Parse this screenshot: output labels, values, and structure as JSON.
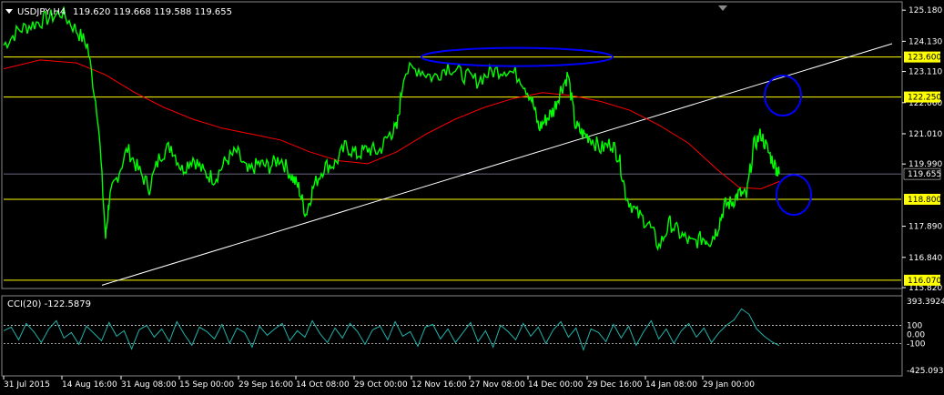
{
  "header": {
    "symbol": "USDJPY,H4",
    "ohlc": "119.620 119.668 119.588 119.655",
    "menu_icon": "triangle-down-icon"
  },
  "cci_header": {
    "label": "CCI(20) -122.5879"
  },
  "colors": {
    "background": "#000000",
    "price": "#00ff00",
    "moving_average": "#ff0000",
    "horizontal_level": "#ffff00",
    "trendline": "#ffffff",
    "ellipse": "#0000ff",
    "cci": "#20b2aa",
    "grid": "#ffffff",
    "highlight_label_bg": "#ffff00",
    "current_price_label_bg": "#000000"
  },
  "chart_data": {
    "type": "line",
    "symbol": "USDJPY",
    "timeframe": "H4",
    "price_axis": {
      "ticks": [
        "125.180",
        "124.130",
        "123.110",
        "122.060",
        "121.010",
        "119.990",
        "117.890",
        "116.840",
        "115.820"
      ],
      "ylim": [
        115.82,
        125.4
      ]
    },
    "time_axis": {
      "ticks": [
        "31 Jul 2015",
        "14 Aug 16:00",
        "31 Aug 08:00",
        "15 Sep 00:00",
        "29 Sep 16:00",
        "14 Oct 08:00",
        "29 Oct 00:00",
        "12 Nov 16:00",
        "27 Nov 08:00",
        "14 Dec 00:00",
        "29 Dec 16:00",
        "14 Jan 08:00",
        "29 Jan 00:00"
      ]
    },
    "levels": [
      {
        "value": 123.6,
        "label": "123.600",
        "color": "#ffff00"
      },
      {
        "value": 122.25,
        "label": "122.250",
        "color": "#ffff00"
      },
      {
        "value": 118.8,
        "label": "118.800",
        "color": "#ffff00"
      },
      {
        "value": 116.07,
        "label": "116.070",
        "color": "#ffff00"
      }
    ],
    "current_price": {
      "value": 119.655,
      "label": "119.655"
    },
    "trendline": {
      "from": {
        "bar": 0.135,
        "price": 115.9
      },
      "to": {
        "bar": 1.22,
        "price": 124.05
      }
    },
    "series": [
      {
        "kind": "price",
        "points": [
          [
            0.0,
            124.0
          ],
          [
            0.02,
            124.5
          ],
          [
            0.04,
            124.7
          ],
          [
            0.06,
            124.9
          ],
          [
            0.08,
            125.1
          ],
          [
            0.1,
            124.5
          ],
          [
            0.115,
            124.0
          ],
          [
            0.13,
            121.5
          ],
          [
            0.14,
            117.5
          ],
          [
            0.145,
            118.8
          ],
          [
            0.155,
            119.5
          ],
          [
            0.17,
            120.5
          ],
          [
            0.185,
            119.8
          ],
          [
            0.2,
            119.2
          ],
          [
            0.215,
            120.3
          ],
          [
            0.23,
            120.6
          ],
          [
            0.245,
            119.8
          ],
          [
            0.26,
            120.2
          ],
          [
            0.275,
            119.7
          ],
          [
            0.29,
            119.5
          ],
          [
            0.305,
            120.1
          ],
          [
            0.32,
            120.4
          ],
          [
            0.335,
            119.7
          ],
          [
            0.35,
            120.0
          ],
          [
            0.365,
            119.9
          ],
          [
            0.38,
            120.2
          ],
          [
            0.395,
            119.6
          ],
          [
            0.405,
            119.2
          ],
          [
            0.415,
            118.3
          ],
          [
            0.425,
            119.2
          ],
          [
            0.44,
            119.9
          ],
          [
            0.455,
            120.0
          ],
          [
            0.47,
            120.6
          ],
          [
            0.485,
            120.3
          ],
          [
            0.5,
            120.5
          ],
          [
            0.515,
            120.4
          ],
          [
            0.53,
            121.0
          ],
          [
            0.54,
            121.2
          ],
          [
            0.55,
            123.1
          ],
          [
            0.57,
            123.2
          ],
          [
            0.59,
            122.9
          ],
          [
            0.61,
            123.3
          ],
          [
            0.63,
            123.0
          ],
          [
            0.65,
            122.8
          ],
          [
            0.67,
            123.1
          ],
          [
            0.69,
            123.2
          ],
          [
            0.71,
            122.9
          ],
          [
            0.725,
            122.2
          ],
          [
            0.735,
            121.2
          ],
          [
            0.745,
            121.5
          ],
          [
            0.755,
            121.8
          ],
          [
            0.765,
            122.5
          ],
          [
            0.775,
            123.0
          ],
          [
            0.785,
            121.3
          ],
          [
            0.795,
            121.0
          ],
          [
            0.805,
            120.9
          ],
          [
            0.82,
            120.5
          ],
          [
            0.835,
            120.7
          ],
          [
            0.845,
            120.2
          ],
          [
            0.855,
            118.9
          ],
          [
            0.87,
            118.3
          ],
          [
            0.885,
            118.0
          ],
          [
            0.9,
            117.2
          ],
          [
            0.915,
            118.0
          ],
          [
            0.93,
            117.6
          ],
          [
            0.945,
            117.3
          ],
          [
            0.96,
            117.5
          ],
          [
            0.97,
            117.4
          ],
          [
            0.98,
            117.8
          ],
          [
            0.99,
            118.6
          ],
          [
            1.0,
            118.7
          ],
          [
            1.01,
            119.0
          ],
          [
            1.02,
            118.9
          ],
          [
            1.03,
            120.6
          ],
          [
            1.04,
            121.0
          ],
          [
            1.05,
            120.4
          ],
          [
            1.06,
            119.9
          ],
          [
            1.065,
            119.655
          ]
        ]
      },
      {
        "kind": "moving_average",
        "points": [
          [
            0.0,
            123.2
          ],
          [
            0.05,
            123.5
          ],
          [
            0.1,
            123.4
          ],
          [
            0.14,
            123.0
          ],
          [
            0.18,
            122.4
          ],
          [
            0.22,
            121.9
          ],
          [
            0.26,
            121.5
          ],
          [
            0.3,
            121.2
          ],
          [
            0.34,
            121.0
          ],
          [
            0.38,
            120.8
          ],
          [
            0.42,
            120.4
          ],
          [
            0.46,
            120.1
          ],
          [
            0.5,
            120.0
          ],
          [
            0.54,
            120.4
          ],
          [
            0.58,
            121.0
          ],
          [
            0.62,
            121.5
          ],
          [
            0.66,
            121.9
          ],
          [
            0.7,
            122.2
          ],
          [
            0.74,
            122.4
          ],
          [
            0.78,
            122.3
          ],
          [
            0.82,
            122.1
          ],
          [
            0.86,
            121.8
          ],
          [
            0.9,
            121.3
          ],
          [
            0.94,
            120.7
          ],
          [
            0.98,
            119.8
          ],
          [
            1.01,
            119.2
          ],
          [
            1.04,
            119.15
          ],
          [
            1.065,
            119.4
          ]
        ]
      }
    ],
    "cci": {
      "name": "CCI(20)",
      "current": -122.5879,
      "axis_labels": [
        "393.3924",
        "100",
        "0.00",
        "-100",
        "-425.0932"
      ],
      "ylim": [
        -425.0932,
        393.3924
      ],
      "levels": [
        100,
        -100
      ],
      "values": [
        40,
        80,
        -60,
        120,
        30,
        -90,
        60,
        150,
        -40,
        20,
        -110,
        90,
        10,
        -70,
        130,
        -20,
        40,
        -160,
        50,
        100,
        -30,
        60,
        -80,
        140,
        0,
        -120,
        80,
        30,
        -50,
        110,
        -100,
        70,
        20,
        -140,
        90,
        -10,
        60,
        120,
        -70,
        40,
        -30,
        150,
        10,
        -90,
        70,
        -40,
        120,
        30,
        -110,
        50,
        90,
        -60,
        140,
        -20,
        30,
        -130,
        80,
        110,
        -50,
        60,
        -90,
        20,
        130,
        -80,
        40,
        -140,
        100,
        30,
        -60,
        120,
        -20,
        80,
        -100,
        50,
        140,
        -30,
        70,
        -170,
        60,
        20,
        -80,
        110,
        -40,
        90,
        -120,
        30,
        150,
        -50,
        60,
        -100,
        40,
        120,
        -30,
        70,
        -90,
        20,
        100,
        160,
        280,
        220,
        60,
        -20,
        -80,
        -122.5879
      ]
    },
    "annotations": [
      {
        "type": "ellipse",
        "label": "resistance-top",
        "center_bar": 0.705,
        "center_price": 123.6
      },
      {
        "type": "ellipse",
        "label": "trendline-retest",
        "center_bar": 1.07,
        "center_price": 122.3
      },
      {
        "type": "ellipse",
        "label": "support-118.8",
        "center_bar": 1.085,
        "center_price": 118.95
      }
    ]
  }
}
